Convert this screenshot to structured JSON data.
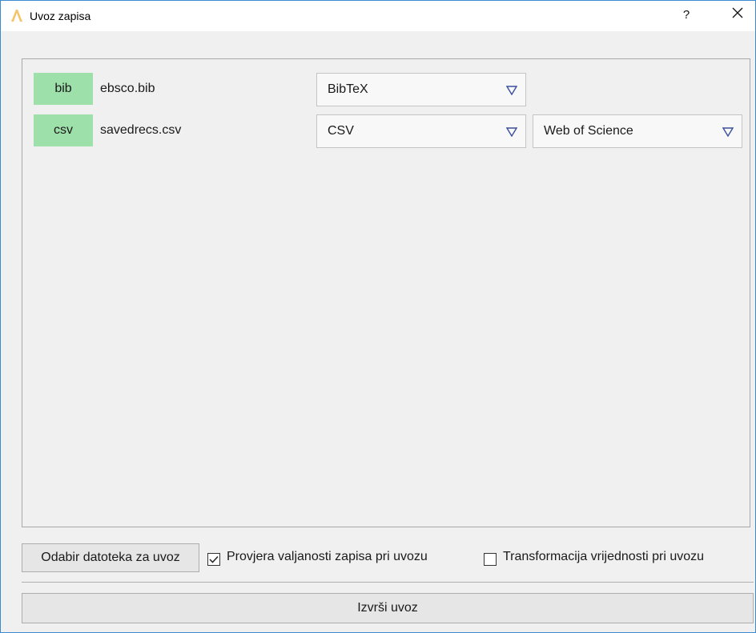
{
  "window": {
    "title": "Uvoz zapisa",
    "help_label": "?",
    "icons": {
      "app": "app-logo-icon",
      "close": "close-icon"
    }
  },
  "files": [
    {
      "badge": "bib",
      "name": "ebsco.bib",
      "format": "BibTeX",
      "source": ""
    },
    {
      "badge": "csv",
      "name": "savedrecs.csv",
      "format": "CSV",
      "source": "Web of Science"
    }
  ],
  "controls": {
    "choose_files_label": "Odabir datoteka za uvoz",
    "validate_label": "Provjera valjanosti zapisa pri uvozu",
    "validate_checked": true,
    "transform_label": "Transformacija vrijednosti pri uvozu",
    "transform_checked": false,
    "execute_label": "Izvrši uvoz"
  },
  "colors": {
    "badge_bg": "#9de0a9",
    "window_border": "#3c8ad0",
    "combo_arrow": "#3a4fa0"
  }
}
